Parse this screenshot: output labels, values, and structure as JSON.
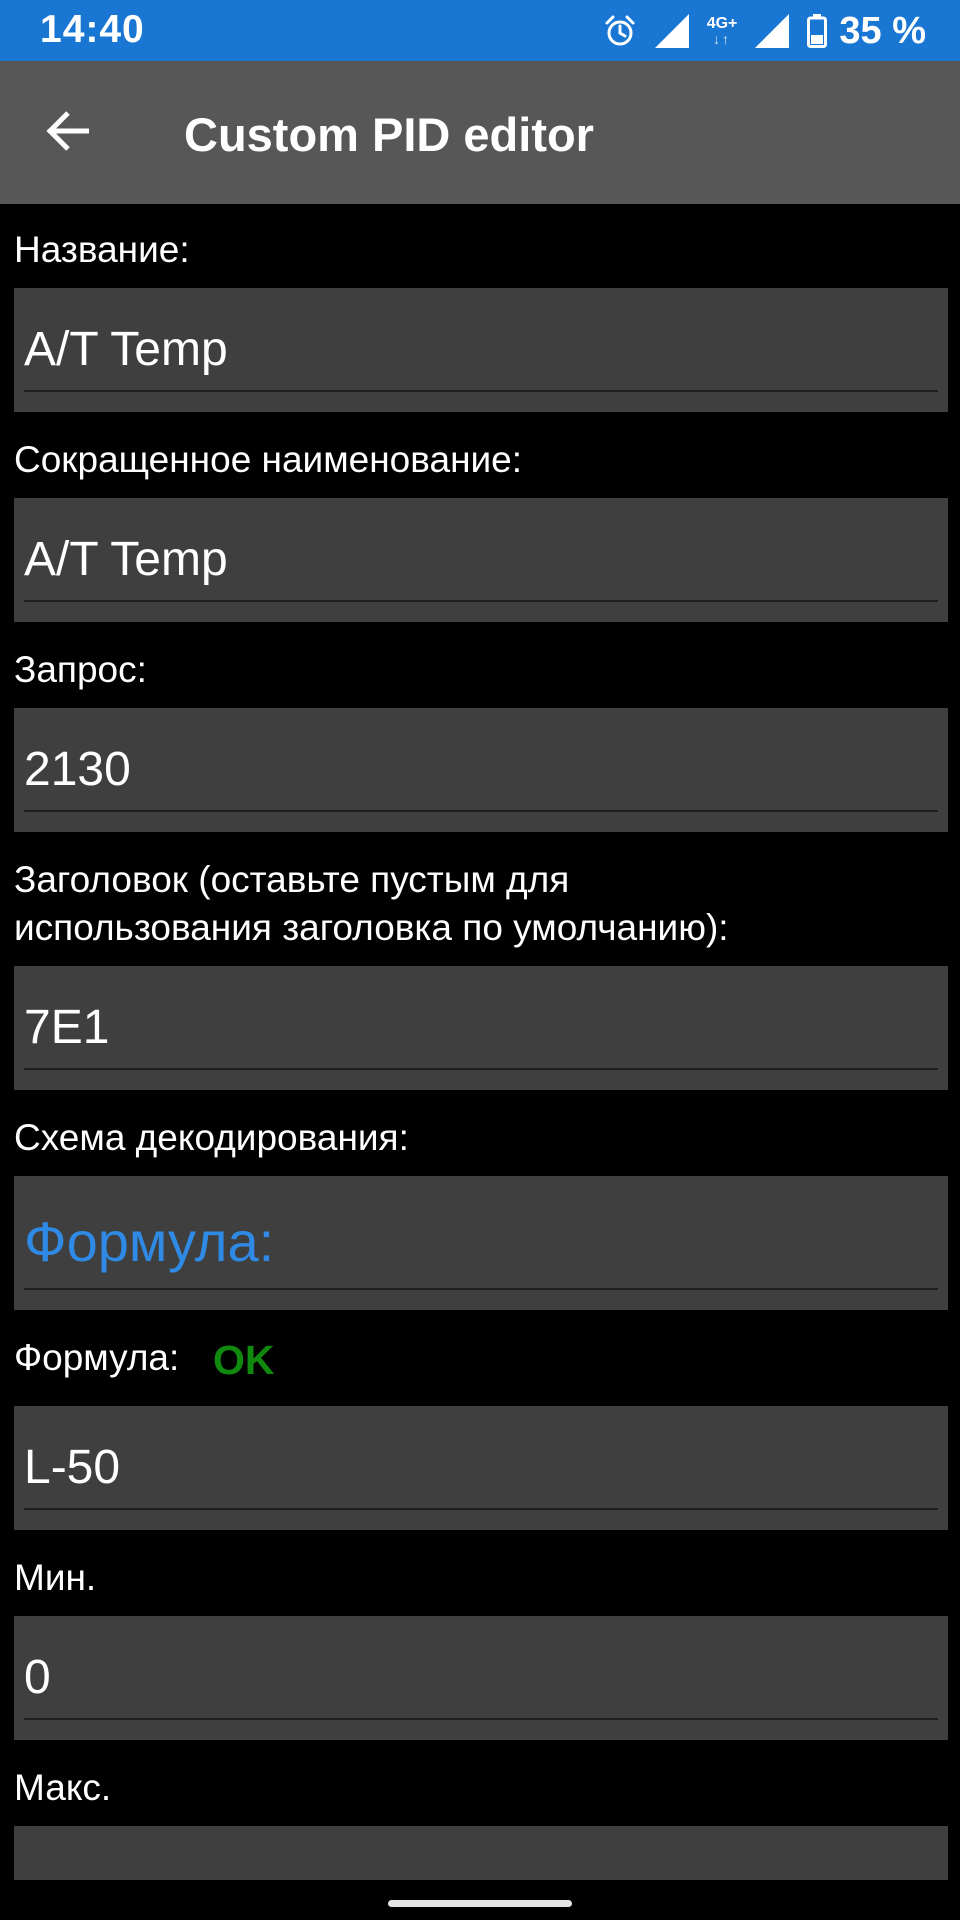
{
  "status_bar": {
    "time": "14:40",
    "network": "4G+",
    "network_arrows": "↓↑",
    "battery": "35 %",
    "icons": [
      "alarm-icon",
      "signal-icon",
      "signal-icon",
      "battery-icon"
    ]
  },
  "app_bar": {
    "title": "Custom PID editor",
    "back_icon": "arrow-back-icon"
  },
  "form": {
    "name": {
      "label": "Название:",
      "value": "A/T Temp"
    },
    "short_name": {
      "label": "Сокращенное наименование:",
      "value": "A/T Temp"
    },
    "request": {
      "label": "Запрос:",
      "value": "2130"
    },
    "header": {
      "label_line1": "Заголовок (оставьте пустым для",
      "label_line2": "использования заголовка по умолчанию):",
      "value": "7E1"
    },
    "decoding_scheme": {
      "label": "Схема декодирования:",
      "value": "Формула:"
    },
    "formula": {
      "label": "Формула:",
      "status": "OK",
      "value": "L-50"
    },
    "min": {
      "label": "Мин.",
      "value": "0"
    },
    "max": {
      "label": "Макс."
    }
  },
  "colors": {
    "status_bar": "#1976d2",
    "app_bar": "#575757",
    "field_bg": "#3f3f3f",
    "accent": "#2f8ae6",
    "ok": "#0f8a0f"
  }
}
